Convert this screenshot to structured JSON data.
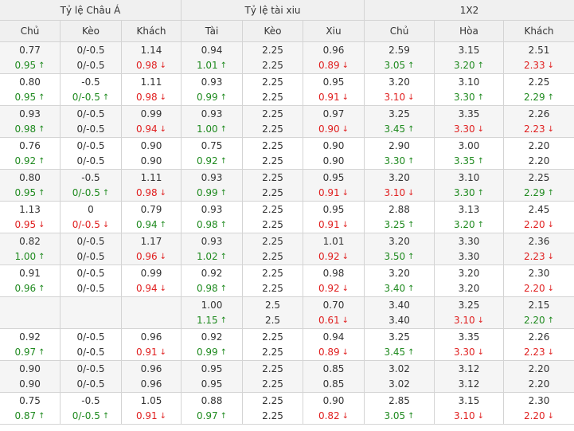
{
  "headers": {
    "asian": "Tỷ lệ Châu Á",
    "overunder": "Tỷ lệ tài xiu",
    "x12": "1X2"
  },
  "columns": [
    "Chủ",
    "Kèo",
    "Khách",
    "Tài",
    "Kèo",
    "Xiu",
    "Chủ",
    "Hòa",
    "Khách"
  ],
  "colors": {
    "up": "#1f8a1f",
    "down": "#e02020",
    "border": "#d4d4d4",
    "header_bg": "#f0f0f0",
    "alt_row_bg": "#f5f5f5"
  },
  "rows": [
    [
      [
        "0.77",
        ""
      ],
      [
        "0.95",
        "up"
      ],
      [
        "0/-0.5",
        ""
      ],
      [
        "0/-0.5",
        ""
      ],
      [
        "1.14",
        ""
      ],
      [
        "0.98",
        "down"
      ],
      [
        "0.94",
        ""
      ],
      [
        "1.01",
        "up"
      ],
      [
        "2.25",
        ""
      ],
      [
        "2.25",
        ""
      ],
      [
        "0.96",
        ""
      ],
      [
        "0.89",
        "down"
      ],
      [
        "2.59",
        ""
      ],
      [
        "3.05",
        "up"
      ],
      [
        "3.15",
        ""
      ],
      [
        "3.20",
        "up"
      ],
      [
        "2.51",
        ""
      ],
      [
        "2.33",
        "down"
      ]
    ],
    [
      [
        "0.80",
        ""
      ],
      [
        "0.95",
        "up"
      ],
      [
        "-0.5",
        ""
      ],
      [
        "0/-0.5",
        "up"
      ],
      [
        "1.11",
        ""
      ],
      [
        "0.98",
        "down"
      ],
      [
        "0.93",
        ""
      ],
      [
        "0.99",
        "up"
      ],
      [
        "2.25",
        ""
      ],
      [
        "2.25",
        ""
      ],
      [
        "0.95",
        ""
      ],
      [
        "0.91",
        "down"
      ],
      [
        "3.20",
        ""
      ],
      [
        "3.10",
        "down"
      ],
      [
        "3.10",
        ""
      ],
      [
        "3.30",
        "up"
      ],
      [
        "2.25",
        ""
      ],
      [
        "2.29",
        "up"
      ]
    ],
    [
      [
        "0.93",
        ""
      ],
      [
        "0.98",
        "up"
      ],
      [
        "0/-0.5",
        ""
      ],
      [
        "0/-0.5",
        ""
      ],
      [
        "0.99",
        ""
      ],
      [
        "0.94",
        "down"
      ],
      [
        "0.93",
        ""
      ],
      [
        "1.00",
        "up"
      ],
      [
        "2.25",
        ""
      ],
      [
        "2.25",
        ""
      ],
      [
        "0.97",
        ""
      ],
      [
        "0.90",
        "down"
      ],
      [
        "3.25",
        ""
      ],
      [
        "3.45",
        "up"
      ],
      [
        "3.35",
        ""
      ],
      [
        "3.30",
        "down"
      ],
      [
        "2.26",
        ""
      ],
      [
        "2.23",
        "down"
      ]
    ],
    [
      [
        "0.76",
        ""
      ],
      [
        "0.92",
        "up"
      ],
      [
        "0/-0.5",
        ""
      ],
      [
        "0/-0.5",
        ""
      ],
      [
        "0.90",
        ""
      ],
      [
        "0.90",
        ""
      ],
      [
        "0.75",
        ""
      ],
      [
        "0.92",
        "up"
      ],
      [
        "2.25",
        ""
      ],
      [
        "2.25",
        ""
      ],
      [
        "0.90",
        ""
      ],
      [
        "0.90",
        ""
      ],
      [
        "2.90",
        ""
      ],
      [
        "3.30",
        "up"
      ],
      [
        "3.00",
        ""
      ],
      [
        "3.35",
        "up"
      ],
      [
        "2.20",
        ""
      ],
      [
        "2.20",
        ""
      ]
    ],
    [
      [
        "0.80",
        ""
      ],
      [
        "0.95",
        "up"
      ],
      [
        "-0.5",
        ""
      ],
      [
        "0/-0.5",
        "up"
      ],
      [
        "1.11",
        ""
      ],
      [
        "0.98",
        "down"
      ],
      [
        "0.93",
        ""
      ],
      [
        "0.99",
        "up"
      ],
      [
        "2.25",
        ""
      ],
      [
        "2.25",
        ""
      ],
      [
        "0.95",
        ""
      ],
      [
        "0.91",
        "down"
      ],
      [
        "3.20",
        ""
      ],
      [
        "3.10",
        "down"
      ],
      [
        "3.10",
        ""
      ],
      [
        "3.30",
        "up"
      ],
      [
        "2.25",
        ""
      ],
      [
        "2.29",
        "up"
      ]
    ],
    [
      [
        "1.13",
        ""
      ],
      [
        "0.95",
        "down"
      ],
      [
        "0",
        ""
      ],
      [
        "0/-0.5",
        "down"
      ],
      [
        "0.79",
        ""
      ],
      [
        "0.94",
        "up"
      ],
      [
        "0.93",
        ""
      ],
      [
        "0.98",
        "up"
      ],
      [
        "2.25",
        ""
      ],
      [
        "2.25",
        ""
      ],
      [
        "0.95",
        ""
      ],
      [
        "0.91",
        "down"
      ],
      [
        "2.88",
        ""
      ],
      [
        "3.25",
        "up"
      ],
      [
        "3.13",
        ""
      ],
      [
        "3.20",
        "up"
      ],
      [
        "2.45",
        ""
      ],
      [
        "2.20",
        "down"
      ]
    ],
    [
      [
        "0.82",
        ""
      ],
      [
        "1.00",
        "up"
      ],
      [
        "0/-0.5",
        ""
      ],
      [
        "0/-0.5",
        ""
      ],
      [
        "1.17",
        ""
      ],
      [
        "0.96",
        "down"
      ],
      [
        "0.93",
        ""
      ],
      [
        "1.02",
        "up"
      ],
      [
        "2.25",
        ""
      ],
      [
        "2.25",
        ""
      ],
      [
        "1.01",
        ""
      ],
      [
        "0.92",
        "down"
      ],
      [
        "3.20",
        ""
      ],
      [
        "3.50",
        "up"
      ],
      [
        "3.30",
        ""
      ],
      [
        "3.30",
        ""
      ],
      [
        "2.36",
        ""
      ],
      [
        "2.23",
        "down"
      ]
    ],
    [
      [
        "0.91",
        ""
      ],
      [
        "0.96",
        "up"
      ],
      [
        "0/-0.5",
        ""
      ],
      [
        "0/-0.5",
        ""
      ],
      [
        "0.99",
        ""
      ],
      [
        "0.94",
        "down"
      ],
      [
        "0.92",
        ""
      ],
      [
        "0.98",
        "up"
      ],
      [
        "2.25",
        ""
      ],
      [
        "2.25",
        ""
      ],
      [
        "0.98",
        ""
      ],
      [
        "0.92",
        "down"
      ],
      [
        "3.20",
        ""
      ],
      [
        "3.40",
        "up"
      ],
      [
        "3.20",
        ""
      ],
      [
        "3.20",
        ""
      ],
      [
        "2.30",
        ""
      ],
      [
        "2.20",
        "down"
      ]
    ],
    [
      [
        "",
        ""
      ],
      [
        "",
        ""
      ],
      [
        "",
        ""
      ],
      [
        "",
        ""
      ],
      [
        "",
        ""
      ],
      [
        "",
        ""
      ],
      [
        "1.00",
        ""
      ],
      [
        "1.15",
        "up"
      ],
      [
        "2.5",
        ""
      ],
      [
        "2.5",
        ""
      ],
      [
        "0.70",
        ""
      ],
      [
        "0.61",
        "down"
      ],
      [
        "3.40",
        ""
      ],
      [
        "3.40",
        ""
      ],
      [
        "3.25",
        ""
      ],
      [
        "3.10",
        "down"
      ],
      [
        "2.15",
        ""
      ],
      [
        "2.20",
        "up"
      ]
    ],
    [
      [
        "0.92",
        ""
      ],
      [
        "0.97",
        "up"
      ],
      [
        "0/-0.5",
        ""
      ],
      [
        "0/-0.5",
        ""
      ],
      [
        "0.96",
        ""
      ],
      [
        "0.91",
        "down"
      ],
      [
        "0.92",
        ""
      ],
      [
        "0.99",
        "up"
      ],
      [
        "2.25",
        ""
      ],
      [
        "2.25",
        ""
      ],
      [
        "0.94",
        ""
      ],
      [
        "0.89",
        "down"
      ],
      [
        "3.25",
        ""
      ],
      [
        "3.45",
        "up"
      ],
      [
        "3.35",
        ""
      ],
      [
        "3.30",
        "down"
      ],
      [
        "2.26",
        ""
      ],
      [
        "2.23",
        "down"
      ]
    ],
    [
      [
        "0.90",
        ""
      ],
      [
        "0.90",
        ""
      ],
      [
        "0/-0.5",
        ""
      ],
      [
        "0/-0.5",
        ""
      ],
      [
        "0.96",
        ""
      ],
      [
        "0.96",
        ""
      ],
      [
        "0.95",
        ""
      ],
      [
        "0.95",
        ""
      ],
      [
        "2.25",
        ""
      ],
      [
        "2.25",
        ""
      ],
      [
        "0.85",
        ""
      ],
      [
        "0.85",
        ""
      ],
      [
        "3.02",
        ""
      ],
      [
        "3.02",
        ""
      ],
      [
        "3.12",
        ""
      ],
      [
        "3.12",
        ""
      ],
      [
        "2.20",
        ""
      ],
      [
        "2.20",
        ""
      ]
    ],
    [
      [
        "0.75",
        ""
      ],
      [
        "0.87",
        "up"
      ],
      [
        "-0.5",
        ""
      ],
      [
        "0/-0.5",
        "up"
      ],
      [
        "1.05",
        ""
      ],
      [
        "0.91",
        "down"
      ],
      [
        "0.88",
        ""
      ],
      [
        "0.97",
        "up"
      ],
      [
        "2.25",
        ""
      ],
      [
        "2.25",
        ""
      ],
      [
        "0.90",
        ""
      ],
      [
        "0.82",
        "down"
      ],
      [
        "2.85",
        ""
      ],
      [
        "3.05",
        "up"
      ],
      [
        "3.15",
        ""
      ],
      [
        "3.10",
        "down"
      ],
      [
        "2.30",
        ""
      ],
      [
        "2.20",
        "down"
      ]
    ]
  ]
}
